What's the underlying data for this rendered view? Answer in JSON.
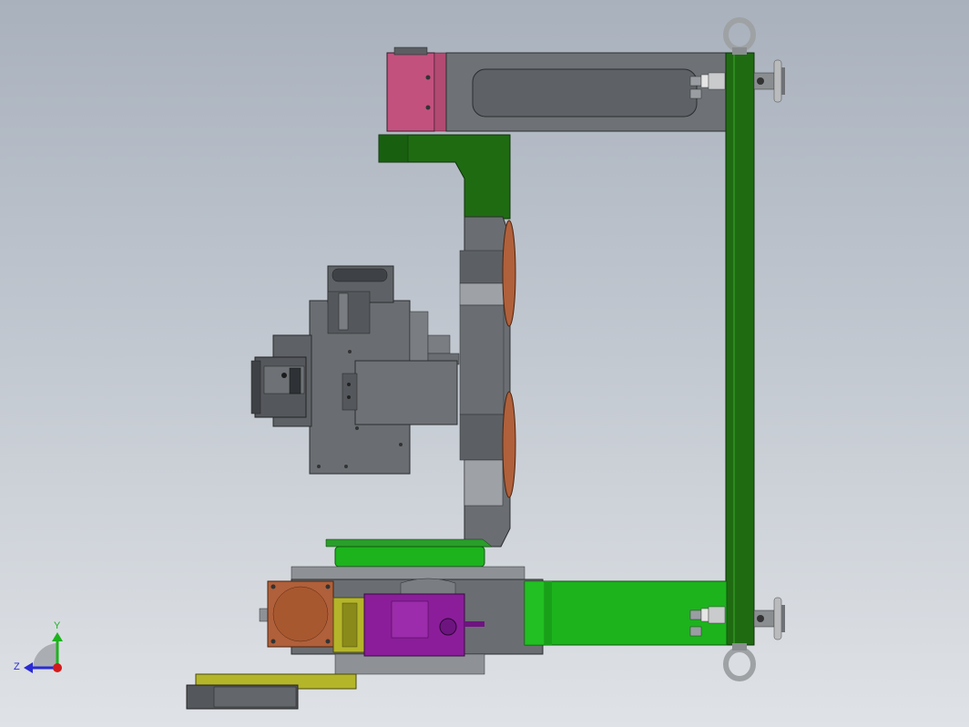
{
  "view": {
    "name": "cad-3d-viewport",
    "background_top": "#a9b1bd",
    "background_bottom": "#dfe2e6"
  },
  "triad": {
    "y_label": "Y",
    "z_label": "Z",
    "y_color": "#1db31d",
    "z_color": "#2a2ad6",
    "x_color": "#d41a1a"
  },
  "part_colors": {
    "steel_dark": "#54585c",
    "steel_mid": "#6e7276",
    "steel_light": "#8e9296",
    "green_dark": "#1f6b12",
    "green_bright": "#1db31d",
    "pink": "#c2517e",
    "copper": "#b0603a",
    "purple": "#8b1d9a",
    "olive": "#b5b52a"
  }
}
